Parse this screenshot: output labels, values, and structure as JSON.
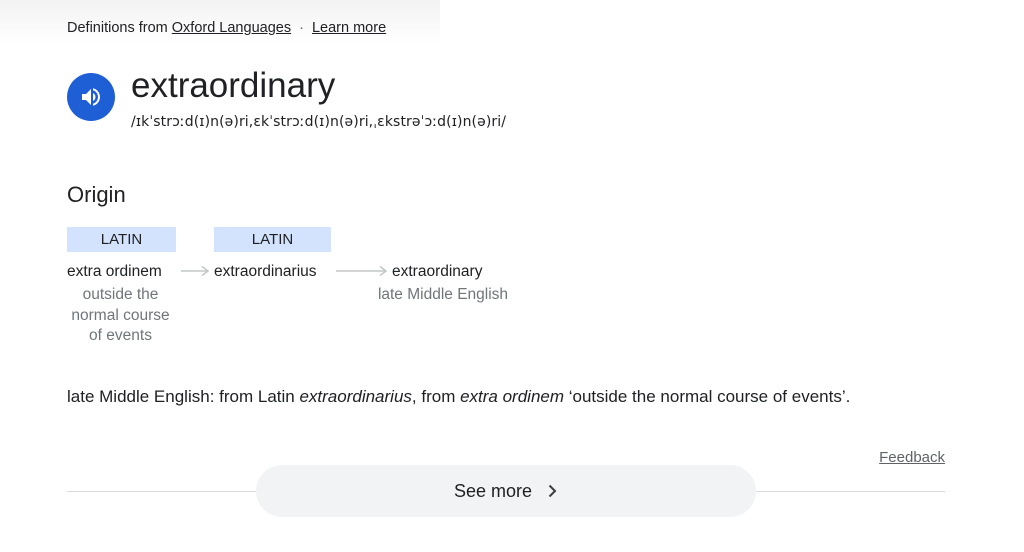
{
  "source": {
    "prefix": "Definitions from",
    "provider_link": "Oxford Languages",
    "separator": "·",
    "learn_more": "Learn more"
  },
  "entry": {
    "audio_icon": "speaker-icon",
    "word": "extraordinary",
    "phonetic": "/ɪkˈstrɔːd(ɪ)n(ə)ri,ɛkˈstrɔːd(ɪ)n(ə)ri,ˌɛkstrəˈɔːd(ɪ)n(ə)ri/"
  },
  "origin": {
    "title": "Origin",
    "badges": [
      "LATIN",
      "LATIN"
    ],
    "terms": [
      "extra ordinem",
      "extraordinarius",
      "extraordinary"
    ],
    "gloss1": "outside the normal course of events",
    "gloss3": "late Middle English"
  },
  "summary": {
    "part1": "late Middle English: from Latin ",
    "italic1": "extraordinarius",
    "part2": ", from ",
    "italic2": "extra ordinem",
    "part3": " ‘outside the normal course of events’."
  },
  "feedback": "Feedback",
  "see_more": {
    "label": "See more",
    "icon": "chevron-right-icon"
  },
  "colors": {
    "speaker_bg": "#1f5fd6",
    "badge_bg": "#d3e3fd",
    "muted_text": "#70757a",
    "button_bg": "#f1f3f4"
  }
}
